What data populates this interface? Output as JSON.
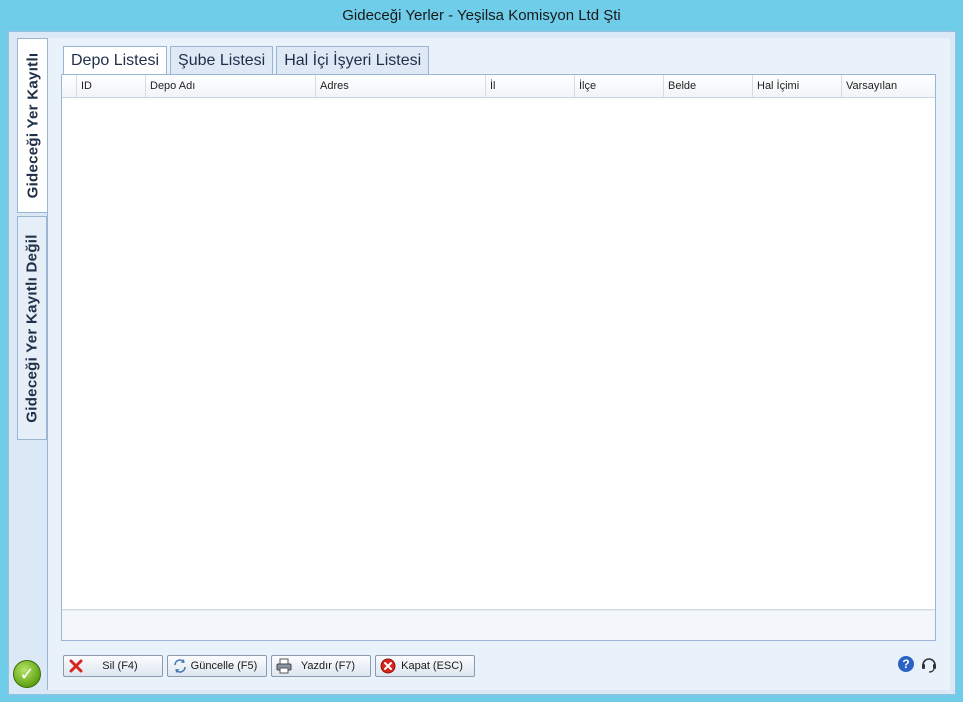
{
  "window": {
    "title": "Gideceği Yerler - Yeşilsa Komisyon Ltd Şti"
  },
  "side_tabs": [
    {
      "label": "Gideceği Yer Kayıtlı",
      "active": true
    },
    {
      "label": "Gideceği Yer Kayıtlı Değil",
      "active": false
    }
  ],
  "tabs": [
    {
      "label": "Depo Listesi",
      "active": true
    },
    {
      "label": "Şube Listesi",
      "active": false
    },
    {
      "label": "Hal İçi İşyeri Listesi",
      "active": false
    }
  ],
  "grid": {
    "columns": [
      "ID",
      "Depo Adı",
      "Adres",
      "İl",
      "İlçe",
      "Belde",
      "Hal İçimi",
      "Varsayılan"
    ],
    "rows": []
  },
  "buttons": {
    "sil": "Sil (F4)",
    "guncelle": "Güncelle (F5)",
    "yazdir": "Yazdır (F7)",
    "kapat": "Kapat (ESC)"
  },
  "icons": {
    "delete": "delete-x-icon",
    "refresh": "refresh-icon",
    "print": "printer-icon",
    "close": "close-circle-icon",
    "help": "help-icon",
    "support": "headset-icon",
    "ok": "check-icon"
  },
  "colors": {
    "title_bar": "#6fcdea",
    "panel": "#e9f1fb",
    "delete_red": "#d9261c",
    "ok_green": "#5fa413",
    "help_blue": "#2a62c6"
  }
}
